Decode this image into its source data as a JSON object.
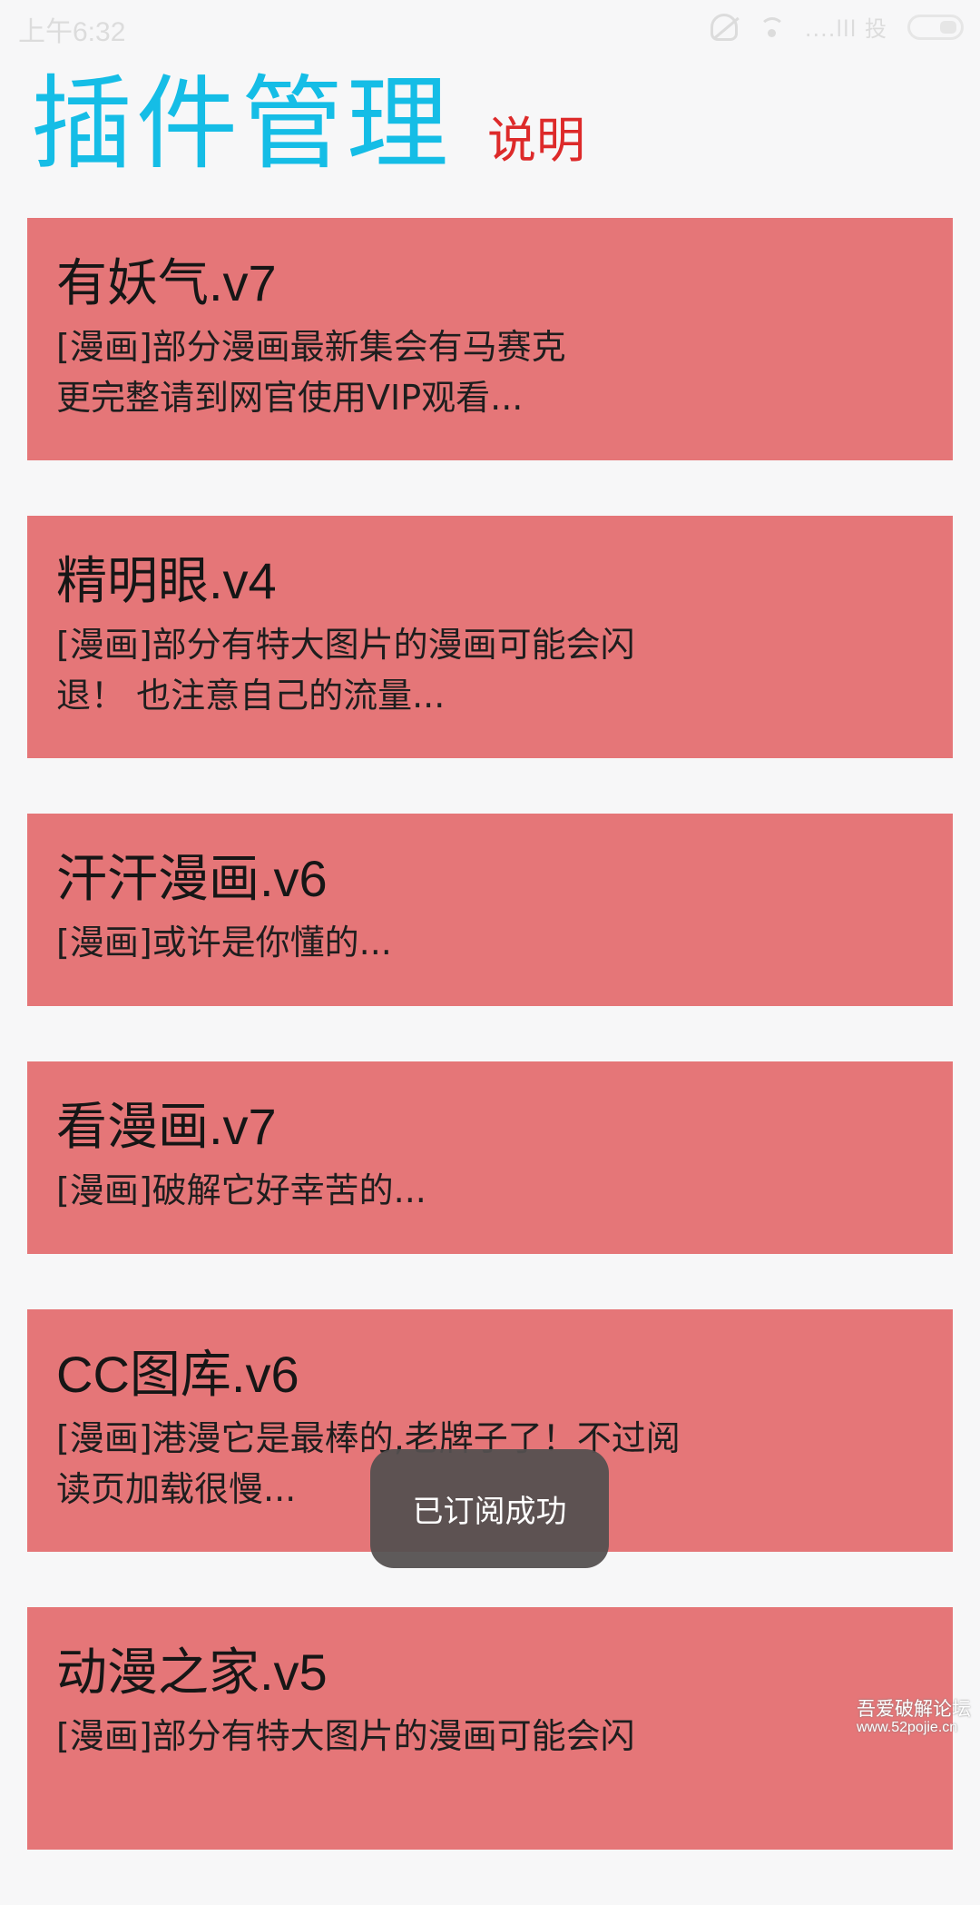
{
  "status_bar": {
    "time": "上午6:32",
    "signal_text": "....lll 投",
    "icons": [
      "alarm-off-icon",
      "wifi-icon",
      "signal-icon",
      "battery-icon"
    ]
  },
  "header": {
    "title": "插件管理",
    "help_label": "说明"
  },
  "plugins": [
    {
      "name": "有妖气.v7",
      "description": "[漫画]部分漫画最新集会有马赛克\n更完整请到网官使用VIP观看..."
    },
    {
      "name": "精明眼.v4",
      "description": "[漫画]部分有特大图片的漫画可能会闪\n退！ 也注意自己的流量..."
    },
    {
      "name": "汗汗漫画.v6",
      "description": "[漫画]或许是你懂的..."
    },
    {
      "name": "看漫画.v7",
      "description": "[漫画]破解它好幸苦的..."
    },
    {
      "name": "CC图库.v6",
      "description": "[漫画]港漫它是最棒的,老牌子了！不过阅\n读页加载很慢..."
    },
    {
      "name": "动漫之家.v5",
      "description": "[漫画]部分有特大图片的漫画可能会闪"
    }
  ],
  "toast": {
    "message": "已订阅成功"
  },
  "watermark": {
    "line1": "吾爱破解论坛",
    "line2": "www.52pojie.cn"
  },
  "colors": {
    "background": "#f7f7f8",
    "title": "#15bde6",
    "help_link": "#dd2a2a",
    "card": "#e57678",
    "toast_bg": "#545050"
  }
}
